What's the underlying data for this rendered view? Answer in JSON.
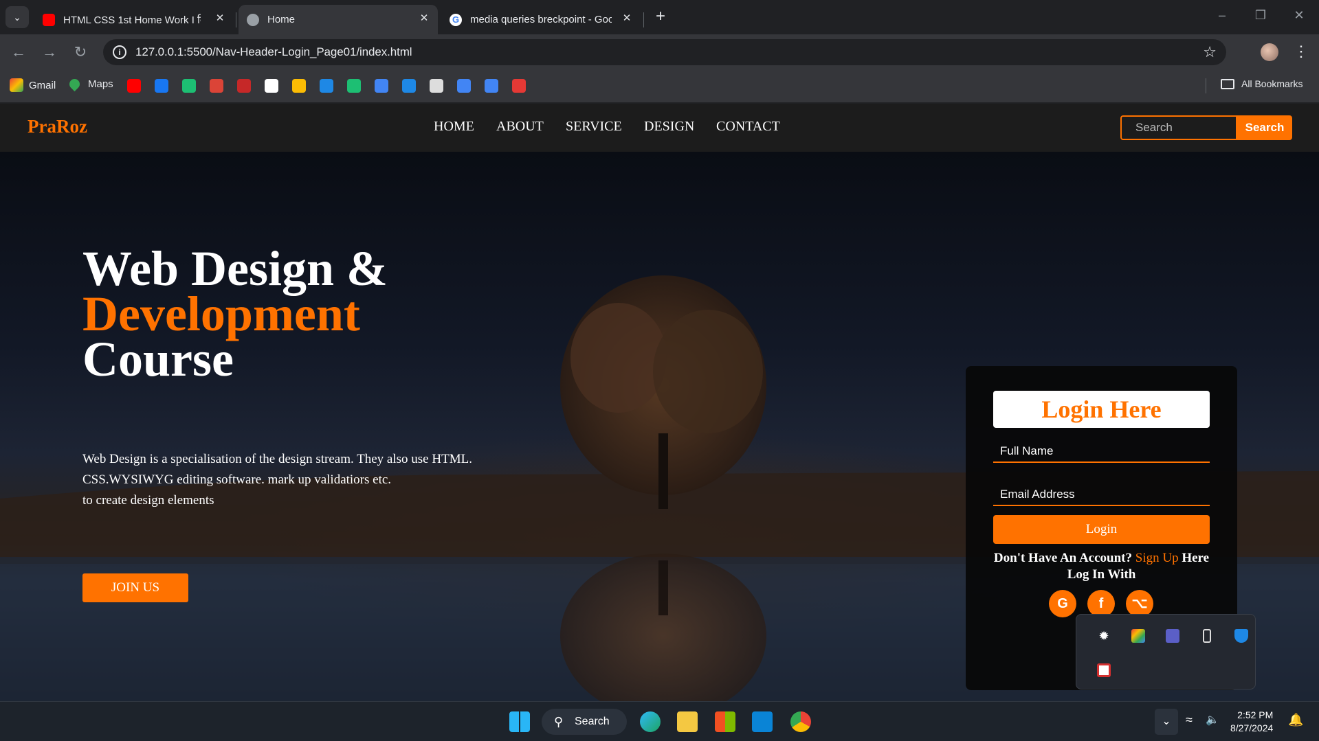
{
  "browser": {
    "tabs": [
      {
        "title": "HTML CSS 1st Home Work I कि",
        "favicon": "youtube-icon",
        "active": false
      },
      {
        "title": "Home",
        "favicon": "globe-icon",
        "active": true
      },
      {
        "title": "media queries breckpoint - Goo",
        "favicon": "google-icon",
        "active": false
      }
    ],
    "new_tab": "+",
    "url": "127.0.0.1:5500/Nav-Header-Login_Page01/index.html",
    "bookmarks": [
      {
        "label": "Gmail",
        "icon": "gmail-icon",
        "color": "#ea4335"
      },
      {
        "label": "Maps",
        "icon": "maps-icon",
        "color": "#34a853"
      }
    ],
    "bookmark_icons": [
      {
        "icon": "youtube-icon",
        "color": "#ff0000"
      },
      {
        "icon": "facebook-icon",
        "color": "#1877f2"
      },
      {
        "icon": "fiverr-icon",
        "color": "#1dbf73"
      },
      {
        "icon": "chrome-icon",
        "color": "#db4437"
      },
      {
        "icon": "speed-icon",
        "color": "#c62828"
      },
      {
        "icon": "chatgpt-icon",
        "color": "#ffffff"
      },
      {
        "icon": "keep-icon",
        "color": "#fbbc04"
      },
      {
        "icon": "messenger-icon",
        "color": "#1e88e5"
      },
      {
        "icon": "fiverr-icon",
        "color": "#1dbf73"
      },
      {
        "icon": "globe-icon",
        "color": "#4285f4"
      },
      {
        "icon": "at-icon",
        "color": "#1e88e5"
      },
      {
        "icon": "notes-icon",
        "color": "#dddddd"
      },
      {
        "icon": "docs-icon",
        "color": "#4285f4"
      },
      {
        "icon": "docs-icon",
        "color": "#4285f4"
      },
      {
        "icon": "pdf-icon",
        "color": "#e53935"
      }
    ],
    "all_bookmarks": "All Bookmarks"
  },
  "site": {
    "logo": "PraRoz",
    "nav": [
      "HOME",
      "ABOUT",
      "SERVICE",
      "DESIGN",
      "CONTACT"
    ],
    "search_placeholder": "Search",
    "search_button": "Search",
    "accent": "#ff7200",
    "hero": {
      "line1": "Web Design &",
      "line2": "Development",
      "line3": "Course",
      "para1": "Web Design is a specialisation of the design stream. They also use HTML.",
      "para2": "CSS.WYSIWYG editing software. mark up validatiors etc.",
      "para3": "to create design elements",
      "cta": "JOIN US"
    },
    "login": {
      "title": "Login Here",
      "name_placeholder": "Full Name",
      "email_placeholder": "Email Address",
      "button": "Login",
      "signup_prefix": "Don't Have An Account?",
      "signup_link": "Sign Up",
      "signup_suffix": "Here",
      "login_with": "Log In With",
      "socials": [
        {
          "icon": "google-icon",
          "glyph": "G"
        },
        {
          "icon": "facebook-icon",
          "glyph": "f"
        },
        {
          "icon": "github-icon",
          "glyph": "⌥"
        }
      ]
    }
  },
  "taskbar": {
    "search": "Search",
    "time": "2:52 PM",
    "date": "8/27/2024"
  }
}
